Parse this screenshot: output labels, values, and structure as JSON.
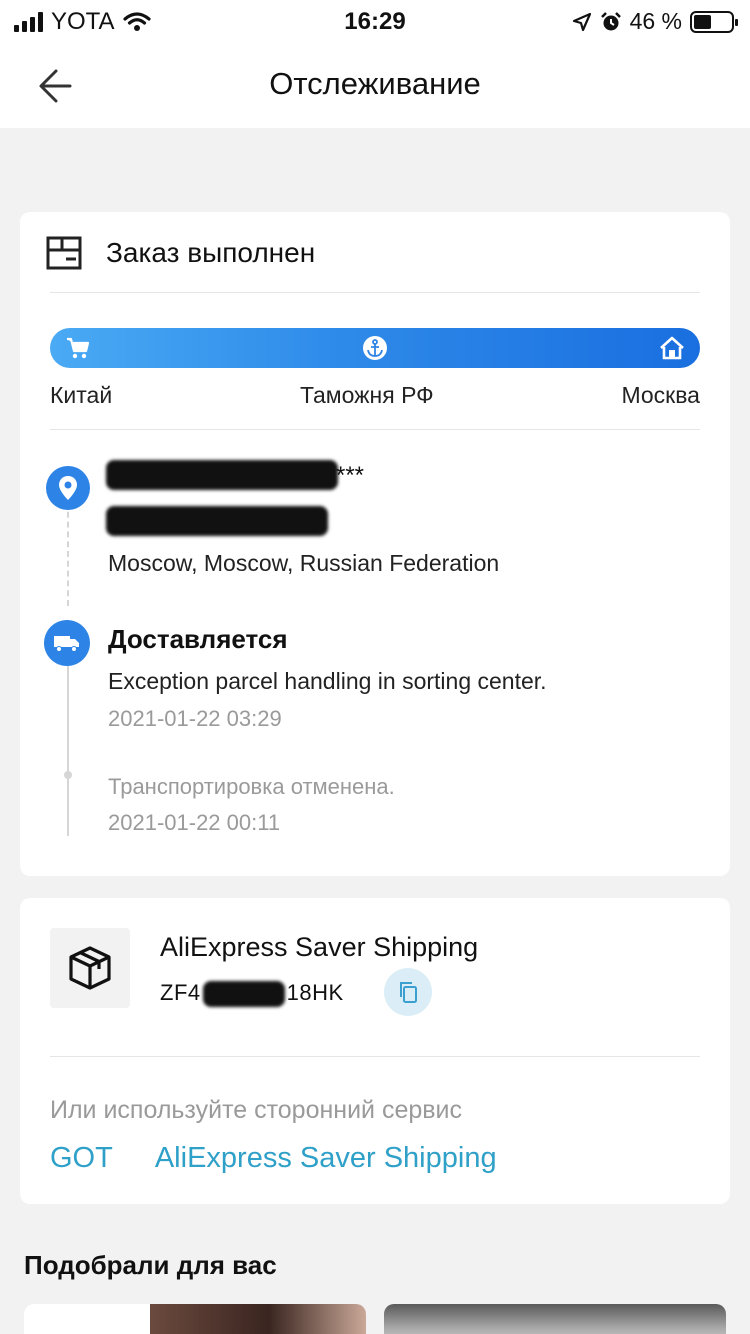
{
  "status_bar": {
    "carrier": "YOTA",
    "time": "16:29",
    "battery": "46 %",
    "battery_level": 0.46
  },
  "header": {
    "title": "Отслеживание",
    "back_icon": "arrow-left-icon"
  },
  "order": {
    "status": "Заказ выполнен",
    "icon": "package-box-icon"
  },
  "route": {
    "stages": [
      "Китай",
      "Таможня РФ",
      "Москва"
    ],
    "icons": [
      "cart-icon",
      "anchor-icon",
      "home-icon"
    ],
    "accent_color": "#2d84e6"
  },
  "recipient": {
    "name_suffix": "***",
    "address": "Moscow, Moscow, Russian Federation"
  },
  "events": [
    {
      "title": "Доставляется",
      "description": "Exception parcel handling in sorting center.",
      "time": "2021-01-22 03:29"
    },
    {
      "note": "Транспортировка отменена.",
      "time": "2021-01-22 00:11"
    }
  ],
  "shipment": {
    "service": "AliExpress Saver Shipping",
    "tracking_prefix": "ZF4",
    "tracking_suffix": "18HK",
    "copy_icon": "copy-icon"
  },
  "alternative": {
    "prompt": "Или используйте сторонний сервис",
    "links": [
      "GOT",
      "AliExpress Saver Shipping"
    ],
    "link_color": "#2fa0c8"
  },
  "recommendations": {
    "title": "Подобрали для вас"
  }
}
